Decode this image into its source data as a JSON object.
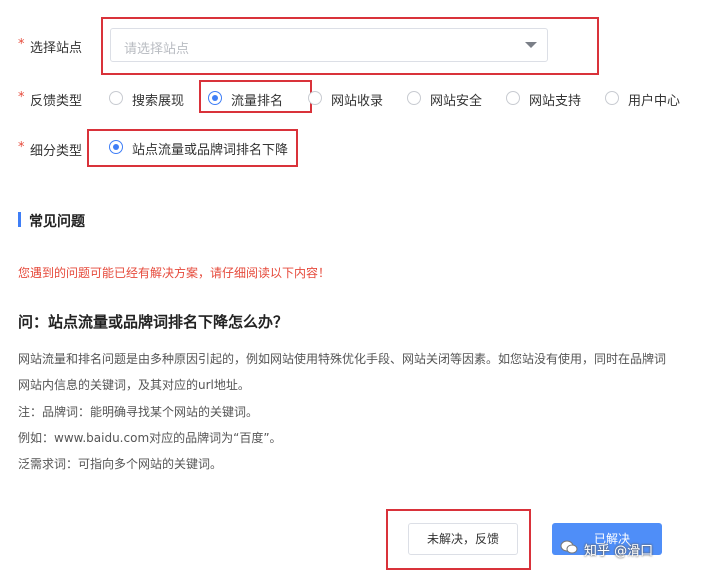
{
  "form": {
    "required_mark": "*",
    "site": {
      "label": "选择站点",
      "placeholder": "请选择站点"
    },
    "feedback_type": {
      "label": "反馈类型",
      "options": [
        {
          "label": "搜索展现",
          "selected": false
        },
        {
          "label": "流量排名",
          "selected": true
        },
        {
          "label": "网站收录",
          "selected": false
        },
        {
          "label": "网站安全",
          "selected": false
        },
        {
          "label": "网站支持",
          "selected": false
        },
        {
          "label": "用户中心",
          "selected": false
        }
      ]
    },
    "sub_type": {
      "label": "细分类型",
      "options": [
        {
          "label": "站点流量或品牌词排名下降",
          "selected": true
        }
      ]
    }
  },
  "faq": {
    "section_title": "常见问题",
    "warning": "您遇到的问题可能已经有解决方案，请仔细阅读以下内容！",
    "question": "问：站点流量或品牌词排名下降怎么办？",
    "answer_lines": [
      "网站流量和排名问题是由多种原因引起的，例如网站使用特殊优化手段、网站关闭等因素。如您站没有使用，同时在品牌词",
      "网站内信息的关键词，及其对应的url地址。",
      "注：品牌词：能明确寻找某个网站的关键词。",
      "例如：www.baidu.com对应的品牌词为“百度”。",
      "泛需求词：可指向多个网站的关键词。"
    ]
  },
  "actions": {
    "unresolved_label": "未解决，反馈",
    "resolved_label": "已解决"
  },
  "watermark": {
    "text": "知乎 @滑口"
  },
  "colors": {
    "accent": "#3f7ef6",
    "required": "#e64a3b",
    "highlight": "#d9323a"
  }
}
